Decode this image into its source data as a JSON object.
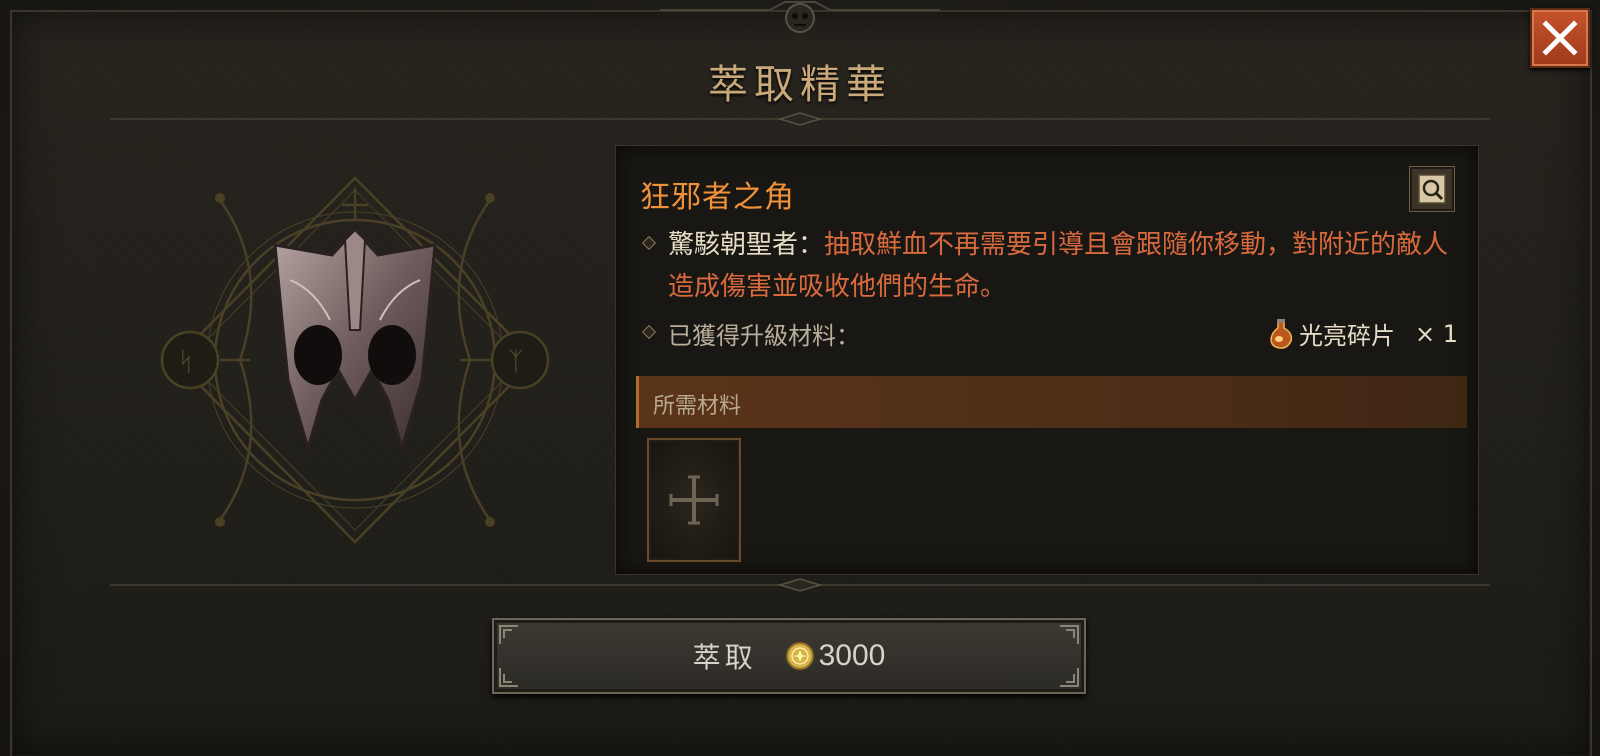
{
  "window": {
    "title": "萃取精華"
  },
  "close_button": {
    "icon": "close-icon",
    "color": "#b4472a"
  },
  "item": {
    "name": "狂邪者之角",
    "name_color": "#f0923a",
    "aspect_name": "驚駭朝聖者",
    "aspect_separator": "：",
    "aspect_description": "抽取鮮血不再需要引導且會跟隨你移動，對附近的敵人造成傷害並吸收他們的生命。",
    "description_color": "#d86a3d"
  },
  "upgrade": {
    "label": "已獲得升級材料：",
    "material_name": "光亮碎片",
    "material_icon": "potion-flask-icon",
    "count_text": "× 1"
  },
  "required": {
    "label": "所需材料",
    "slot_icon": "cross-icon"
  },
  "extract_button": {
    "label": "萃取",
    "currency_icon": "gold-coin-icon",
    "cost": "3000"
  }
}
